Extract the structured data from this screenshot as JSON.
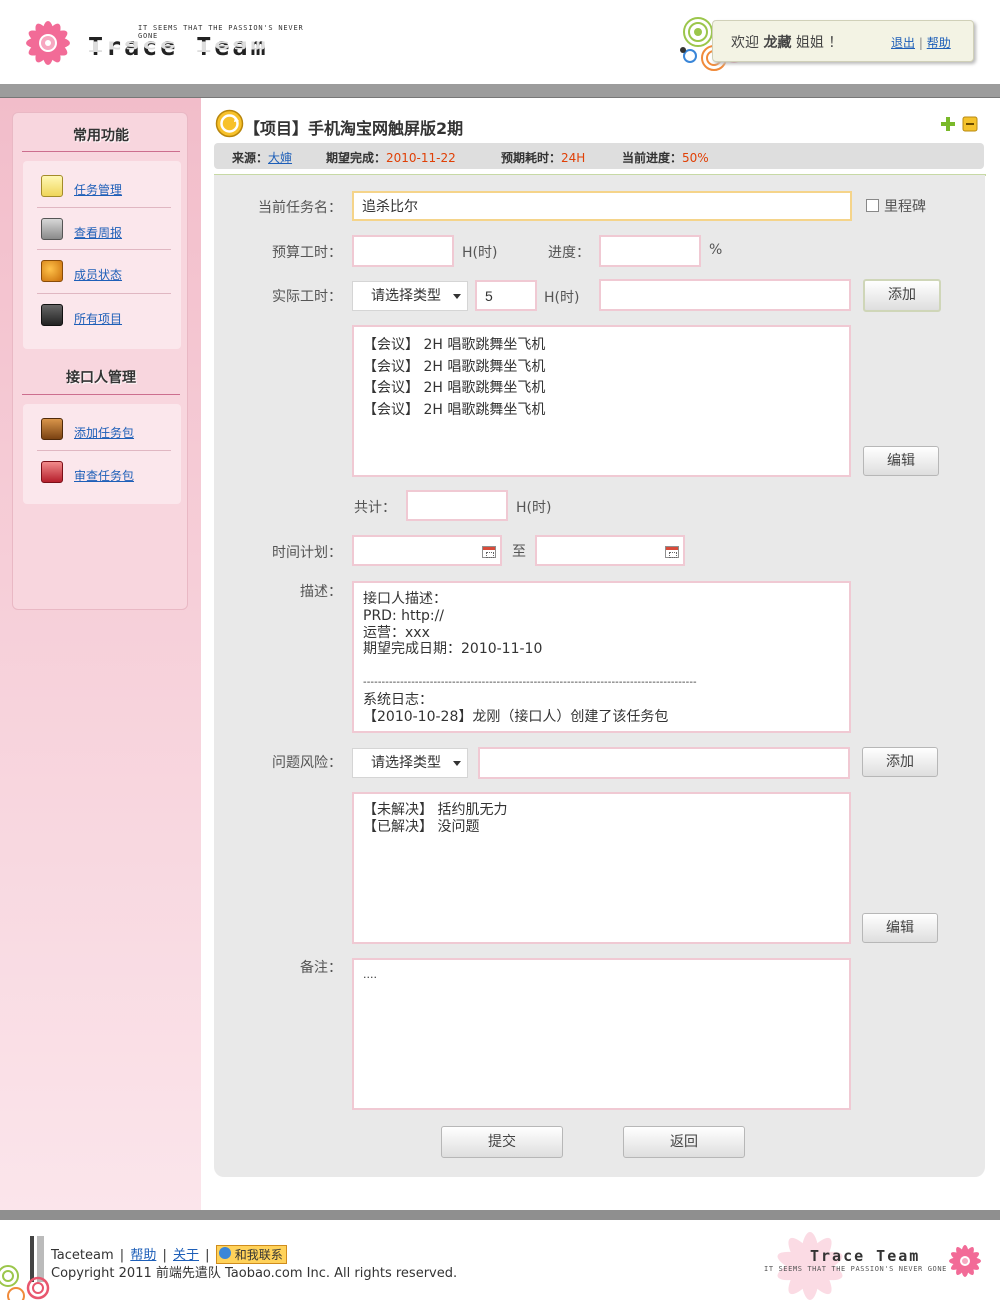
{
  "header": {
    "logo_tagline": "IT SEEMS THAT THE PASSION'S NEVER GONE",
    "logo_text": "Trace Team",
    "welcome_prefix": "欢迎",
    "welcome_user": "龙藏",
    "welcome_suffix": "姐姐 ！",
    "logout_label": "退出",
    "help_label": "帮助",
    "link_separator": "|"
  },
  "sidebar": {
    "section1_title": "常用功能",
    "section1_items": [
      {
        "label": "任务管理",
        "icon": "notepad-icon"
      },
      {
        "label": "查看周报",
        "icon": "newspaper-icon"
      },
      {
        "label": "成员状态",
        "icon": "members-icon"
      },
      {
        "label": "所有项目",
        "icon": "phone-icon"
      }
    ],
    "section2_title": "接口人管理",
    "section2_items": [
      {
        "label": "添加任务包",
        "icon": "package-add-icon"
      },
      {
        "label": "审查任务包",
        "icon": "mail-review-icon"
      }
    ]
  },
  "project": {
    "title": "【项目】手机淘宝网触屏版2期",
    "source_label": "来源：",
    "source_value": "大婶",
    "expected_label": "期望完成：",
    "expected_value": "2010-11-22",
    "estimated_label": "预期耗时：",
    "estimated_value": "24H",
    "progress_label": "当前进度：",
    "progress_value": "50%"
  },
  "form": {
    "task_name_label": "当前任务名：",
    "task_name_value": "追杀比尔",
    "milestone_label": "里程碑",
    "budget_label": "预算工时：",
    "budget_value": "",
    "budget_unit": "H(时)",
    "progress_label": "进度：",
    "progress_value": "",
    "progress_unit": "%",
    "actual_label": "实际工时：",
    "actual_type_selected": "请选择类型",
    "actual_hours_value": "5",
    "actual_unit": "H(时)",
    "actual_note_value": "",
    "add_label": "添加",
    "actual_entries": [
      "【会议】 2H 唱歌跳舞坐飞机",
      "【会议】 2H 唱歌跳舞坐飞机",
      "【会议】 2H 唱歌跳舞坐飞机",
      "【会议】 2H 唱歌跳舞坐飞机"
    ],
    "edit_label": "编辑",
    "total_label": "共计：",
    "total_value": "",
    "total_unit": "H(时)",
    "schedule_label": "时间计划：",
    "schedule_to": "至",
    "schedule_start": "",
    "schedule_end": "",
    "desc_label": "描述：",
    "desc_lines": [
      "接口人描述：",
      "PRD: http://",
      "运营：xxx",
      "期望完成日期：2010-11-10",
      "",
      "------------------------------------------------------------------------------------------",
      "系统日志：",
      "【2010-10-28】龙刚（接口人）创建了该任务包"
    ],
    "risk_label": "问题风险：",
    "risk_type_selected": "请选择类型",
    "risk_note_value": "",
    "risk_entries": [
      "【未解决】 括约肌无力",
      "【已解决】 没问题"
    ],
    "remark_label": "备注：",
    "remark_value": "....",
    "submit_label": "提交",
    "back_label": "返回"
  },
  "footer": {
    "brand": "Taceteam",
    "help_label": "帮助",
    "about_label": "关于",
    "separator": "|",
    "contact_label": "和我联系",
    "copyright": "Copyright 2011 前端先遣队 Taobao.com Inc. All rights reserved.",
    "logo_text": "Trace Team",
    "logo_tagline": "IT SEEMS THAT THE PASSION'S NEVER GONE"
  },
  "colors": {
    "accent_pink": "#f0c9d3",
    "link_blue": "#1e5fb8",
    "value_red": "#e04006"
  }
}
